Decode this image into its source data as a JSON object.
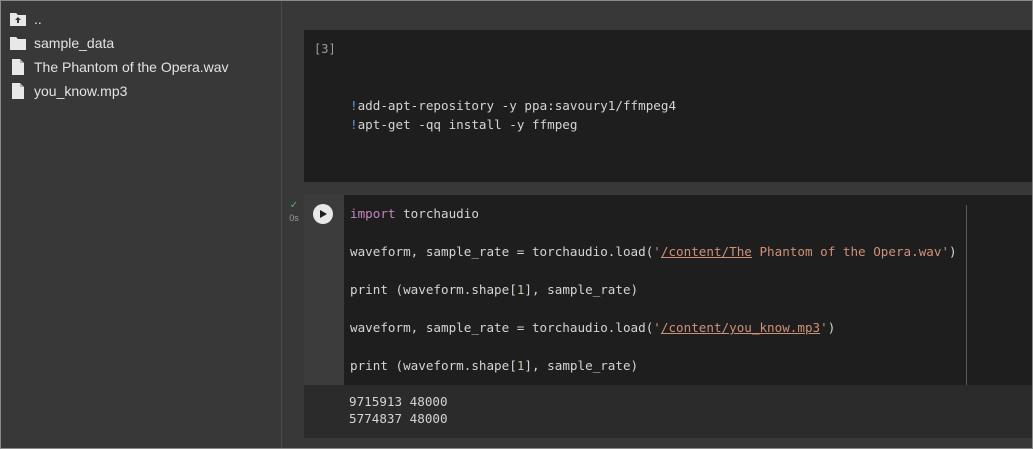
{
  "sidebar": {
    "items": [
      {
        "label": "..",
        "icon": "folder-up-icon"
      },
      {
        "label": "sample_data",
        "icon": "folder-icon"
      },
      {
        "label": "The Phantom of the Opera.wav",
        "icon": "file-icon"
      },
      {
        "label": "you_know.mp3",
        "icon": "file-icon"
      }
    ]
  },
  "cell_prev": {
    "exec_count": "[3]",
    "lines": [
      {
        "bang": "!",
        "text": "add-apt-repository -y ppa:savoury1/ffmpeg4"
      },
      {
        "bang": "!",
        "text": "apt-get -qq install -y ffmpeg"
      }
    ]
  },
  "cell_cur": {
    "status_check": "✓",
    "status_time": "0s",
    "line1": {
      "kw": "import",
      "rest": " torchaudio"
    },
    "line2": {
      "pre": "waveform, sample_rate = torchaudio.load(",
      "q1": "'",
      "url": "/content/The",
      "str_rest": " Phantom of the Opera.wav",
      "q2": "'",
      "post": ")"
    },
    "line3": {
      "pre": "print (waveform.shape[",
      "num": "1",
      "post": "], sample_rate)"
    },
    "line4": {
      "pre": "waveform, sample_rate = torchaudio.load(",
      "q1": "'",
      "url": "/content/you_know.mp3",
      "q2": "'",
      "post": ")"
    },
    "line5": {
      "pre": "print (waveform.shape[",
      "num": "1",
      "post": "], sample_rate)"
    },
    "output": [
      "9715913 48000",
      "5774837 48000"
    ]
  },
  "colors": {
    "keyword": "#c586c0",
    "string": "#ce9178",
    "number": "#b5cea8",
    "bang": "#569cd6",
    "success": "#5fb35f"
  }
}
